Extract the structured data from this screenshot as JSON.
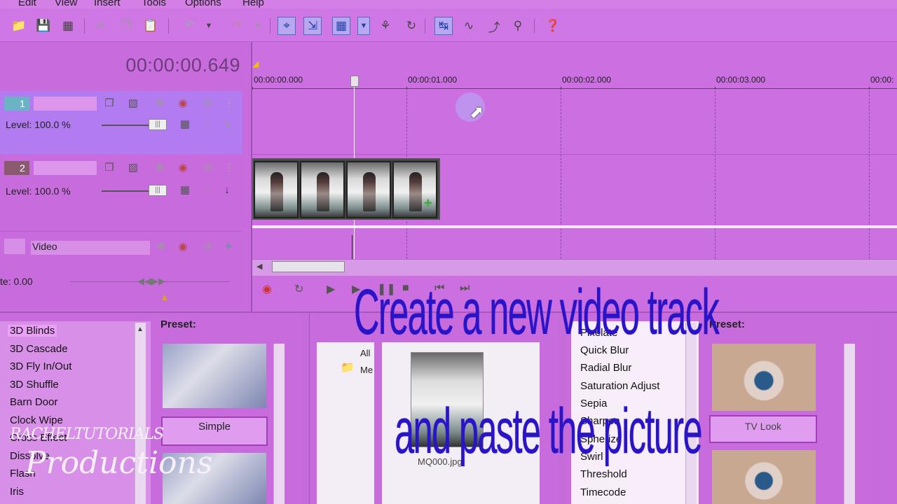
{
  "menu": [
    "Edit",
    "View",
    "Insert",
    "Tools",
    "Options",
    "Help"
  ],
  "timeline": {
    "cursor_time": "00:00:00.649",
    "ruler_labels": [
      "00:00:00.000",
      "00:00:01.000",
      "00:00:02.000",
      "00:00:03.000",
      "00:00:"
    ]
  },
  "tracks": [
    {
      "number": "1",
      "level_label": "Level: 100.0 %"
    },
    {
      "number": "2",
      "level_label": "Level: 100.0 %"
    }
  ],
  "bus_track": {
    "label": "Video"
  },
  "rate": {
    "label": "te: 0.00"
  },
  "transitions": {
    "items": [
      "3D Blinds",
      "3D Cascade",
      "3D Fly In/Out",
      "3D Shuffle",
      "Barn Door",
      "Clock Wipe",
      "Cross Effect",
      "Dissolve",
      "Flash",
      "Iris"
    ],
    "selected": "3D Blinds",
    "preset_title": "Preset:",
    "preset_selected": "Simple"
  },
  "explorer": {
    "tree_items": [
      "All",
      "Me"
    ],
    "file_name": "MQ000.jpg"
  },
  "video_fx": {
    "items": [
      "Pixelate",
      "Quick Blur",
      "Radial Blur",
      "Saturation Adjust",
      "Sepia",
      "Sharpen",
      "Spherize",
      "Swirl",
      "Threshold",
      "Timecode"
    ],
    "preset_title": "Preset:",
    "preset_item": "TV Look"
  },
  "overlay": {
    "line1": "Create a new video track",
    "line2": "and paste the picture"
  },
  "watermark": {
    "line1": "RACHELTUTORIALS",
    "line2": "Productions"
  },
  "colors": {
    "background": "#cc6fe0",
    "caption": "#2a14c8",
    "selected_track": "#b27bf0"
  }
}
